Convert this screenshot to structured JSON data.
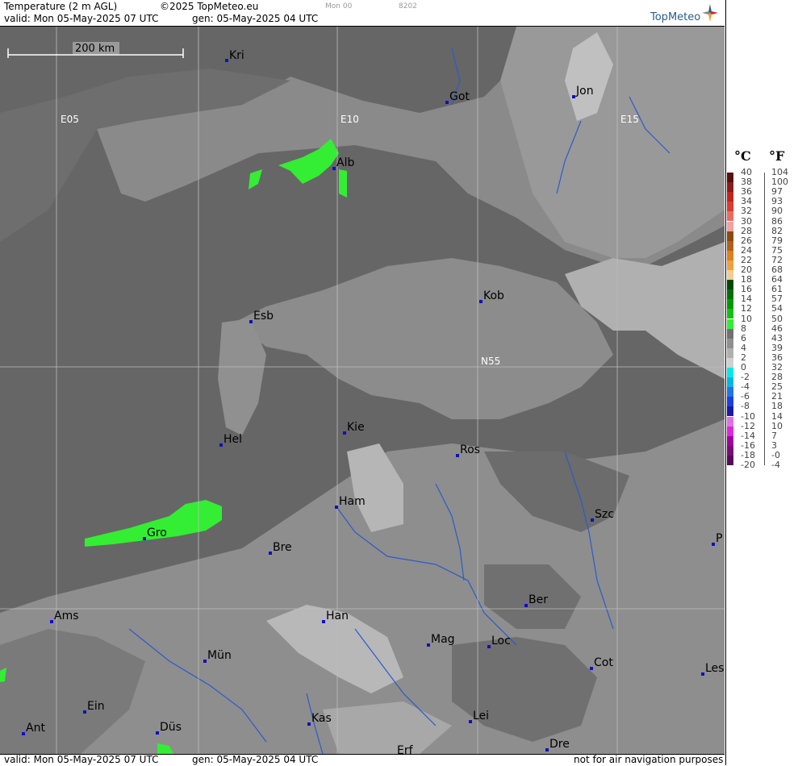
{
  "header": {
    "title": "Temperature (2 m AGL)",
    "copyright": "©2025 TopMeteo.eu",
    "run_code": "Mon 00",
    "code": "8202",
    "valid": "valid:  Mon  05-May-2025  07 UTC",
    "gen": "gen: 05-May-2025 04 UTC",
    "logo": "TopMeteo"
  },
  "footer": {
    "valid": "valid:  Mon  05-May-2025  07 UTC",
    "gen": "gen: 05-May-2025 04 UTC",
    "disclaimer": "not for air navigation purposes"
  },
  "scale": {
    "label": "200 km"
  },
  "grid_labels": {
    "e05": "E05",
    "e10": "E10",
    "e15": "E15",
    "n55": "N55"
  },
  "cities": {
    "kri": "Kri",
    "got": "Got",
    "jon": "Jon",
    "alb": "Alb",
    "esb": "Esb",
    "kob": "Kob",
    "kie": "Kie",
    "hel": "Hel",
    "ros": "Ros",
    "ham": "Ham",
    "szc": "Szc",
    "gro": "Gro",
    "bre": "Bre",
    "p": "P",
    "ber": "Ber",
    "ams": "Ams",
    "han": "Han",
    "mag": "Mag",
    "loc": "Loc",
    "mun": "Mün",
    "cot": "Cot",
    "les": "Les",
    "ein": "Ein",
    "kas": "Kas",
    "lei": "Lei",
    "ant": "Ant",
    "dus": "Düs",
    "dre": "Dre",
    "erf": "Erf"
  },
  "legend": {
    "unit_c": "°C",
    "unit_f": "°F",
    "celsius": [
      "40",
      "38",
      "36",
      "34",
      "32",
      "30",
      "28",
      "26",
      "24",
      "22",
      "20",
      "18",
      "16",
      "14",
      "12",
      "10",
      "8",
      "6",
      "4",
      "2",
      "0",
      "-2",
      "-4",
      "-6",
      "-8",
      "-10",
      "-12",
      "-14",
      "-16",
      "-18",
      "-20"
    ],
    "fahrenheit": [
      "104",
      "100",
      "97",
      "93",
      "90",
      "86",
      "82",
      "79",
      "75",
      "72",
      "68",
      "64",
      "61",
      "57",
      "54",
      "50",
      "46",
      "43",
      "39",
      "36",
      "32",
      "28",
      "25",
      "21",
      "18",
      "14",
      "10",
      "7",
      "3",
      "-0",
      "-4"
    ],
    "colors": [
      "#5a0f0f",
      "#8c1a1a",
      "#c0241e",
      "#dd3b2e",
      "#ee6a60",
      "#f4a0a0",
      "#8a4a10",
      "#b0601a",
      "#e0801c",
      "#f0a040",
      "#f3cc95",
      "#004a00",
      "#007000",
      "#009a00",
      "#12c012",
      "#33ee33",
      "#707070",
      "#909090",
      "#b0b0b0",
      "#d0d0d0",
      "#00eaea",
      "#00b8e8",
      "#1e74e8",
      "#1c3fe0",
      "#1a1aa8",
      "#e070e8",
      "#dc28dc",
      "#a000a0",
      "#7a0a7a",
      "#580a58"
    ]
  }
}
